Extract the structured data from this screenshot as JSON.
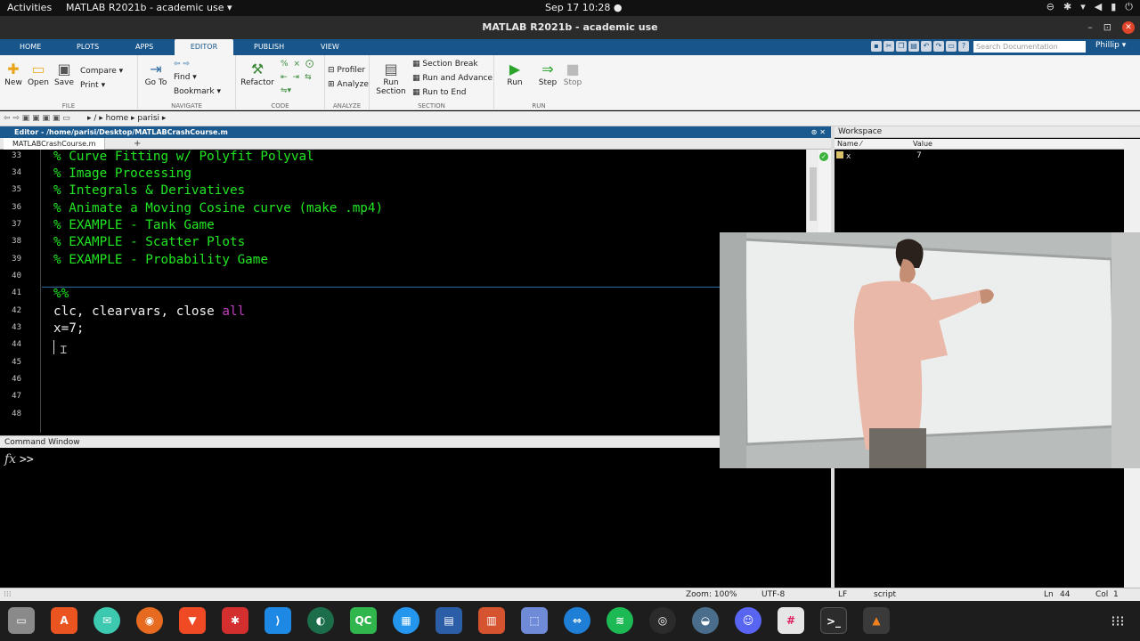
{
  "topbar": {
    "activities": "Activities",
    "app_menu": "MATLAB R2021b - academic use ▾",
    "clock": "Sep 17  10:28  ●"
  },
  "window": {
    "title": "MATLAB R2021b - academic use"
  },
  "ribbon_tabs": [
    "HOME",
    "PLOTS",
    "APPS",
    "EDITOR",
    "PUBLISH",
    "VIEW"
  ],
  "search": {
    "placeholder": "Search Documentation"
  },
  "user": "Phillip ▾",
  "ribbon": {
    "file": {
      "label": "FILE",
      "new": "New",
      "open": "Open",
      "save": "Save",
      "compare": "Compare ▾",
      "print": "Print ▾"
    },
    "navigate": {
      "label": "NAVIGATE",
      "goto": "Go To",
      "find": "Find ▾",
      "bookmark": "Bookmark ▾"
    },
    "code": {
      "label": "CODE",
      "refactor": "Refactor"
    },
    "analyze": {
      "label": "ANALYZE",
      "profiler": "Profiler",
      "analyze": "Analyze"
    },
    "section": {
      "label": "SECTION",
      "run_section": "Run Section",
      "section_break": "Section Break",
      "run_advance": "Run and Advance",
      "run_end": "Run to End"
    },
    "run": {
      "label": "RUN",
      "run": "Run",
      "step": "Step",
      "stop": "Stop"
    }
  },
  "address": {
    "path": "▸ /  ▸  home  ▸  parisi  ▸"
  },
  "editor": {
    "title": "Editor - /home/parisi/Desktop/MATLABCrashCourse.m",
    "tab": "MATLABCrashCourse.m",
    "line_numbers": [
      "33",
      "34",
      "35",
      "36",
      "37",
      "38",
      "39",
      "40",
      "41",
      "42",
      "43",
      "44",
      "45",
      "46",
      "47",
      "48"
    ],
    "lines": {
      "l33": "% Curve Fitting w/ Polyfit Polyval",
      "l34": "% Image Processing",
      "l35": "% Integrals & Derivatives",
      "l36": "% Animate a Moving Cosine curve (make .mp4)",
      "l37": "% EXAMPLE - Tank Game",
      "l38": "% EXAMPLE - Scatter Plots",
      "l39": "% EXAMPLE - Probability Game",
      "l41": "%%",
      "l42_a": "clc, clearvars, close ",
      "l42_kw": "all",
      "l43": "x=7;"
    }
  },
  "command_window": {
    "title": "Command Window",
    "fx": "fx",
    "prompt": ">>"
  },
  "workspace": {
    "title": "Workspace",
    "col_name": "Name ⁄",
    "col_value": "Value",
    "var_name": "x",
    "var_value": "7"
  },
  "status": {
    "zoom": "Zoom: 100%",
    "encoding": "UTF-8",
    "eol": "LF",
    "type": "script",
    "ln_label": "Ln",
    "ln": "44",
    "col_label": "Col",
    "col": "1"
  },
  "colors": {
    "ribbon_blue": "#17558a",
    "comment_green": "#22e622",
    "keyword_purple": "#c040c0"
  }
}
